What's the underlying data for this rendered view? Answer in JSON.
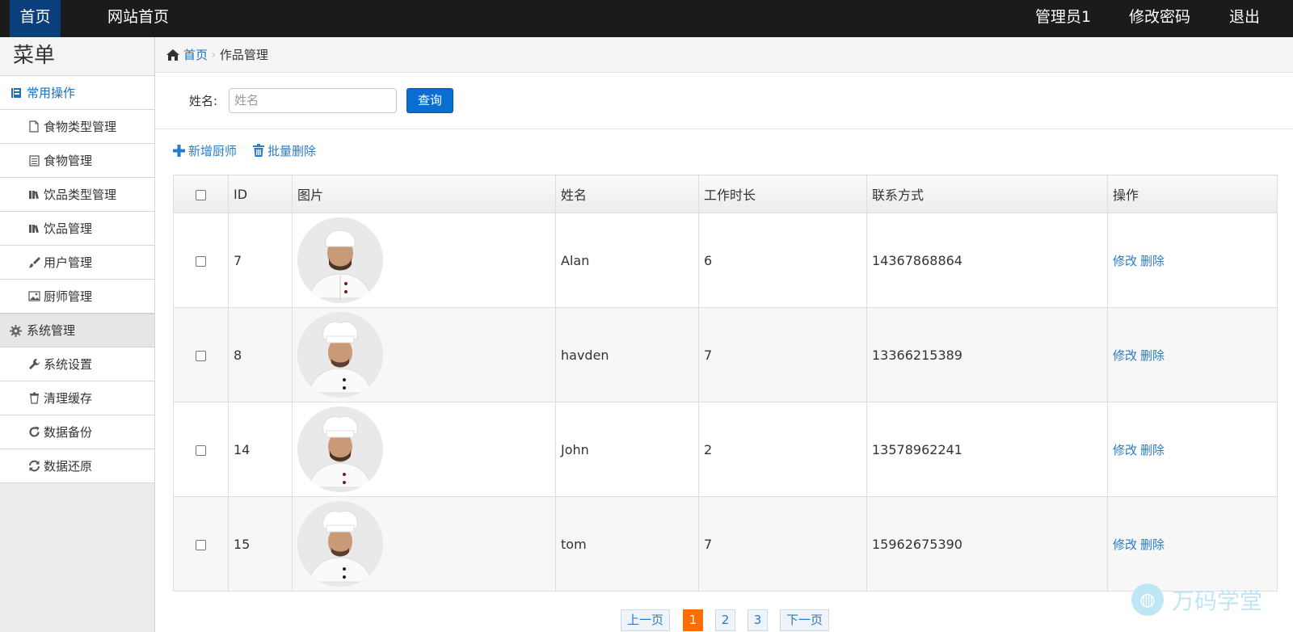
{
  "topbar": {
    "home": "首页",
    "site_home": "网站首页",
    "admin": "管理员1",
    "change_password": "修改密码",
    "logout": "退出"
  },
  "sidebar": {
    "title": "菜单",
    "group1": "常用操作",
    "items1": [
      "食物类型管理",
      "食物管理",
      "饮品类型管理",
      "饮品管理",
      "用户管理",
      "厨师管理"
    ],
    "group2": "系统管理",
    "items2": [
      "系统设置",
      "清理缓存",
      "数据备份",
      "数据还原"
    ]
  },
  "breadcrumb": {
    "home": "首页",
    "current": "作品管理"
  },
  "search": {
    "label": "姓名:",
    "placeholder": "姓名",
    "button": "查询"
  },
  "actions": {
    "add": "新增厨师",
    "batch_delete": "批量删除"
  },
  "table": {
    "headers": [
      "ID",
      "图片",
      "姓名",
      "工作时长",
      "联系方式",
      "操作"
    ],
    "rows": [
      {
        "id": "7",
        "name": "Alan",
        "hours": "6",
        "phone": "14367868864"
      },
      {
        "id": "8",
        "name": "havden",
        "hours": "7",
        "phone": "13366215389"
      },
      {
        "id": "14",
        "name": "John",
        "hours": "2",
        "phone": "13578962241"
      },
      {
        "id": "15",
        "name": "tom",
        "hours": "7",
        "phone": "15962675390"
      }
    ],
    "edit": "修改",
    "delete": "删除"
  },
  "pager": {
    "prev": "上一页",
    "pages": [
      "1",
      "2",
      "3"
    ],
    "current": "1",
    "next": "下一页"
  },
  "watermark": "万码学堂",
  "colors": {
    "topbar": "#1b1b1b",
    "active_tab": "#0a3f7c",
    "link": "#2a7bc4",
    "button": "#0a6ed1",
    "current_page": "#ff6d00"
  }
}
